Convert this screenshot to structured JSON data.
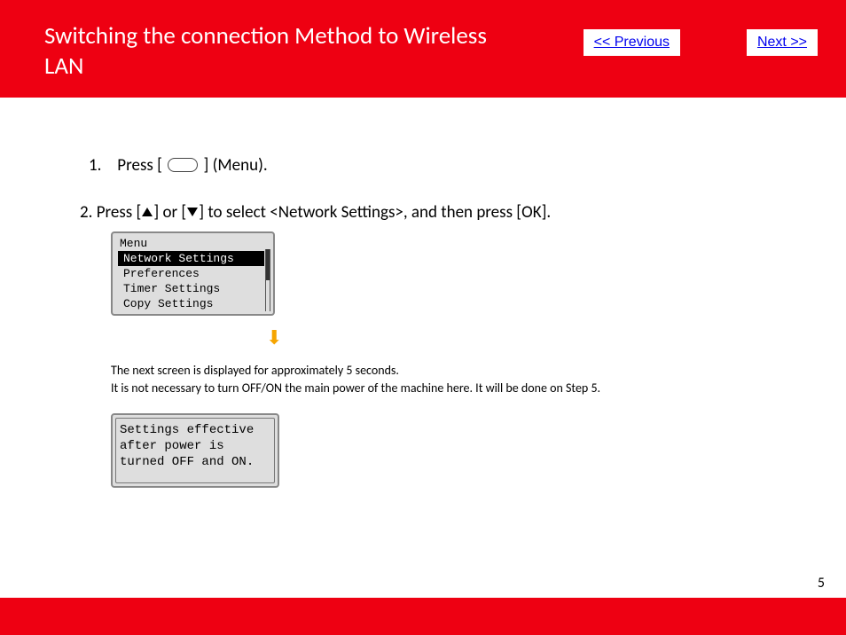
{
  "header": {
    "title": "Switching the connection Method to Wireless LAN"
  },
  "nav": {
    "prev": "<< Previous",
    "next": "Next >>"
  },
  "steps": {
    "one_num": "1.",
    "one_a": "Press [",
    "one_b": "] (Menu).",
    "two": "2. Press [",
    "two_mid": "] or [",
    "two_end": "] to select <Network Settings>, and then press [OK]."
  },
  "lcd1": {
    "title": "Menu",
    "items": [
      "Network Settings",
      "Preferences",
      "Timer Settings",
      "Copy Settings"
    ],
    "selectedIndex": 0
  },
  "note": {
    "line1": "The next screen is displayed for approximately 5 seconds.",
    "line2": "It is not necessary to turn OFF/ON the main power of the machine here. It will be done on Step 5."
  },
  "lcd2": {
    "line1": "Settings effective",
    "line2": "after power is",
    "line3": "turned OFF and ON."
  },
  "pageNumber": "5"
}
